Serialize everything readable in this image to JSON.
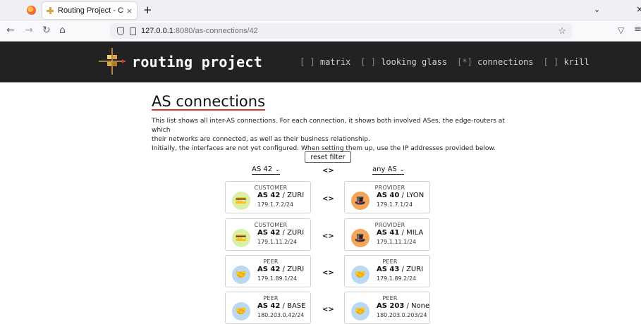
{
  "browser": {
    "tab_title": "Routing Project - Connect",
    "tab_close": "×",
    "new_tab": "+",
    "url_host": "127.0.0.1",
    "url_path": ":8080/as-connections/42"
  },
  "site": {
    "title": "routing project",
    "nav": [
      {
        "mark": "[ ]",
        "label": "matrix"
      },
      {
        "mark": "[ ]",
        "label": "looking glass"
      },
      {
        "mark": "[*]",
        "label": "connections"
      },
      {
        "mark": "[ ]",
        "label": "krill"
      }
    ]
  },
  "main": {
    "heading": "AS connections",
    "intro": [
      "This list shows all inter-AS connections. For each connection, it shows both involved ASes, the edge-routers at which",
      "their networks are connected, as well as their business relationship.",
      "Initially, the interfaces are not yet configured. When setting them up, use the IP addresses provided below."
    ],
    "reset_label": "reset filter",
    "filter_left": "AS 42",
    "filter_right": "any AS",
    "separator": "<>"
  },
  "connections": [
    {
      "left": {
        "role": "CUSTOMER",
        "as": "AS 42",
        "router": "/ ZURI",
        "ip": "179.1.7.2/24",
        "icon": "customer"
      },
      "right": {
        "role": "PROVIDER",
        "as": "AS 40",
        "router": "/ LYON",
        "ip": "179.1.7.1/24",
        "icon": "provider"
      }
    },
    {
      "left": {
        "role": "CUSTOMER",
        "as": "AS 42",
        "router": "/ ZURI",
        "ip": "179.1.11.2/24",
        "icon": "customer"
      },
      "right": {
        "role": "PROVIDER",
        "as": "AS 41",
        "router": "/ MILA",
        "ip": "179.1.11.1/24",
        "icon": "provider"
      }
    },
    {
      "left": {
        "role": "PEER",
        "as": "AS 42",
        "router": "/ ZURI",
        "ip": "179.1.89.1/24",
        "icon": "peer"
      },
      "right": {
        "role": "PEER",
        "as": "AS 43",
        "router": "/ ZURI",
        "ip": "179.1.89.2/24",
        "icon": "peer"
      }
    },
    {
      "left": {
        "role": "PEER",
        "as": "AS 42",
        "router": "/ BASE",
        "ip": "180.203.0.42/24",
        "icon": "peer"
      },
      "right": {
        "role": "PEER",
        "as": "AS 203",
        "router": "/ None",
        "ip": "180.203.0.203/24",
        "icon": "peer"
      }
    }
  ]
}
